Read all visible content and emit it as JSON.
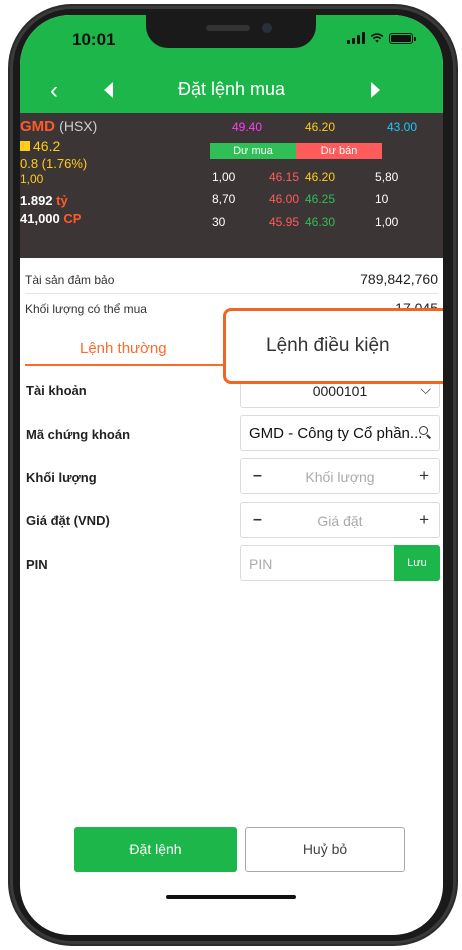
{
  "status": {
    "time": "10:01"
  },
  "header": {
    "title": "Đặt lệnh mua"
  },
  "quote": {
    "symbol": "GMD",
    "exchange": "(HSX)",
    "ceiling": "49.40",
    "reference": "46.20",
    "floor": "43.00",
    "price": "46.2",
    "change": "0.8 (1.76%)",
    "unit_small": "1,00",
    "value": "1.892",
    "value_unit": "tỷ",
    "volume": "41,000",
    "volume_unit": "CP",
    "buy_label": "Dư mua",
    "sell_label": "Dư bán",
    "colors": {
      "ceiling": "#ff3bf5",
      "reference": "#ffcc1a",
      "floor": "#18c8ff",
      "up": "#2fbf56",
      "down": "#ff5b5b"
    },
    "book": [
      {
        "bid_vol": "1,00",
        "bid": "46.15",
        "ask": "46.20",
        "ask_vol": "5,80",
        "ask_color": "#ffcc1a"
      },
      {
        "bid_vol": "8,70",
        "bid": "46.00",
        "ask": "46.25",
        "ask_vol": "10",
        "ask_color": "#2fbf56"
      },
      {
        "bid_vol": "30",
        "bid": "45.95",
        "ask": "46.30",
        "ask_vol": "1,00",
        "ask_color": "#2fbf56"
      }
    ]
  },
  "info": {
    "collateral_label": "Tài sản đảm bảo",
    "collateral_value": "789,842,760",
    "max_vol_label": "Khối lượng có thể mua",
    "max_vol_value": "17,045"
  },
  "tabs": {
    "normal": "Lệnh thường",
    "conditional": "Lệnh điều kiện"
  },
  "form": {
    "account_label": "Tài khoản",
    "account_value": "0000101",
    "stock_label": "Mã chứng khoán",
    "stock_value": "GMD - Công ty Cổ phần...",
    "quantity_label": "Khối lượng",
    "quantity_placeholder": "Khối lượng",
    "price_label": "Giá đặt (VND)",
    "price_placeholder": "Giá đặt",
    "pin_label": "PIN",
    "pin_placeholder": "PIN",
    "pin_save": "Lưu"
  },
  "actions": {
    "place": "Đặt lệnh",
    "cancel": "Huỷ bỏ"
  }
}
